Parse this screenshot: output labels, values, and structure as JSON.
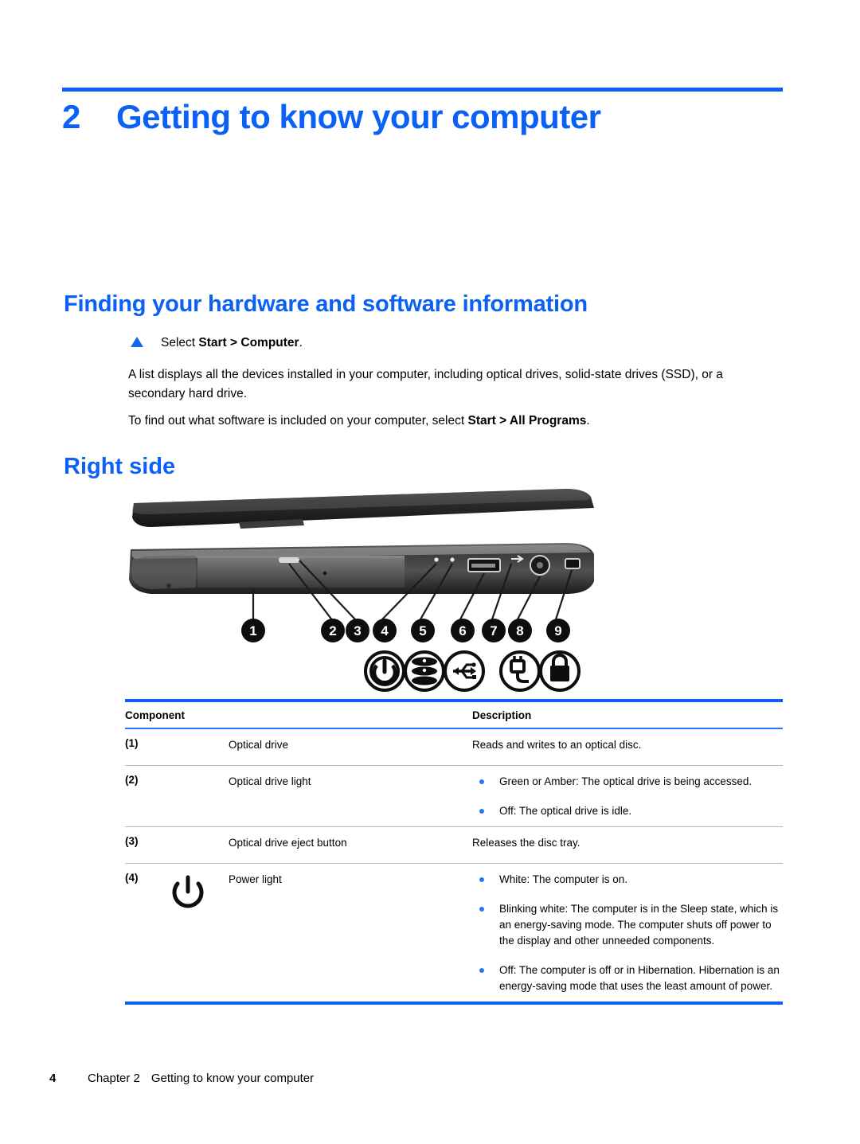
{
  "page": {
    "chapter_number": "2",
    "chapter_title": "Getting to know your computer"
  },
  "sections": {
    "finding": {
      "heading": "Finding your hardware and software information",
      "step": {
        "prefix": "Select ",
        "bold": "Start > Computer",
        "suffix": "."
      },
      "paragraph_1": "A list displays all the devices installed in your computer, including optical drives, solid-state drives (SSD), or a secondary hard drive.",
      "paragraph_2_prefix": "To find out what software is included on your computer, select ",
      "paragraph_2_bold": "Start > All Programs",
      "paragraph_2_suffix": "."
    },
    "right_side": {
      "heading": "Right side"
    }
  },
  "illustration": {
    "name": "laptop-right-side-view",
    "callouts": [
      "1",
      "2",
      "3",
      "4",
      "5",
      "6",
      "7",
      "8",
      "9"
    ],
    "icons": [
      "power-icon",
      "hard-drive-icon",
      "usb-icon",
      "ac-power-connector-icon",
      "security-lock-icon"
    ]
  },
  "table": {
    "headers": {
      "component": "Component",
      "description": "Description"
    },
    "rows": [
      {
        "num": "(1)",
        "icon": "",
        "name": "Optical drive",
        "desc_type": "plain",
        "desc": "Reads and writes to an optical disc."
      },
      {
        "num": "(2)",
        "icon": "",
        "name": "Optical drive light",
        "desc_type": "bullets",
        "bullets": [
          "Green or Amber: The optical drive is being accessed.",
          "Off: The optical drive is idle."
        ]
      },
      {
        "num": "(3)",
        "icon": "",
        "name": "Optical drive eject button",
        "desc_type": "plain",
        "desc": "Releases the disc tray."
      },
      {
        "num": "(4)",
        "icon": "power-icon",
        "name": "Power light",
        "desc_type": "bullets",
        "bullets": [
          "White: The computer is on.",
          "Blinking white: The computer is in the Sleep state, which is an energy-saving mode. The computer shuts off power to the display and other unneeded components.",
          "Off: The computer is off or in Hibernation. Hibernation is an energy-saving mode that uses the least amount of power."
        ]
      }
    ]
  },
  "footer": {
    "page_number": "4",
    "chapter_label": "Chapter 2",
    "chapter_title": "Getting to know your computer"
  },
  "colors": {
    "accent_blue": "#0b61f5",
    "bullet_blue": "#2a74f5",
    "rule_grey": "#b9b9b9"
  }
}
